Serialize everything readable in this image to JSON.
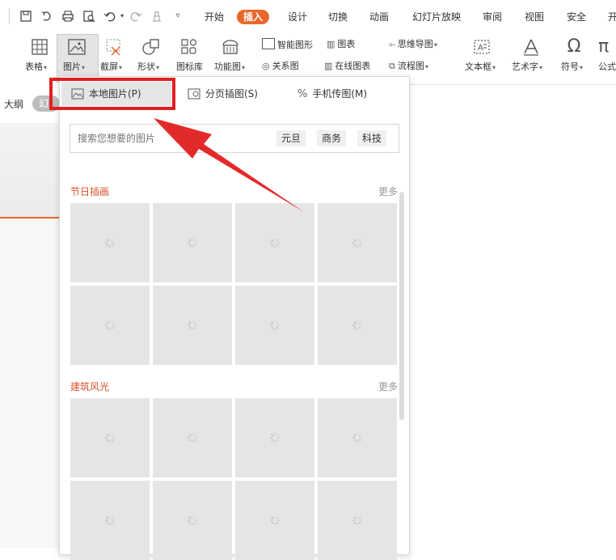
{
  "tabs": [
    "开始",
    "插入",
    "设计",
    "切换",
    "动画",
    "幻灯片放映",
    "审阅",
    "视图",
    "安全",
    "开"
  ],
  "active_tab": "插入",
  "ribbon": {
    "table": "表格",
    "picture": "图片",
    "screenshot": "截屏",
    "shape": "形状",
    "icon_lib": "图标库",
    "function_chart": "功能图",
    "smart_graphic": "智能图形",
    "chart": "图表",
    "mind_map": "思维导图",
    "relation": "关系图",
    "online_chart": "在线图表",
    "flowchart": "流程图",
    "textbox": "文本框",
    "art_text": "艺术字",
    "symbol": "符号",
    "formula": "公式"
  },
  "left_panel": {
    "outline_tab": "大纲",
    "slides_tab_partial": "幻"
  },
  "dropdown": {
    "local_picture": "本地图片(P)",
    "page_illustration": "分页插图(S)",
    "phone_transfer": "手机传图(M)",
    "search_placeholder": "搜索您想要的图片",
    "tags": [
      "元旦",
      "商务",
      "科技"
    ],
    "section1_title": "节日插画",
    "section2_title": "建筑风光",
    "more": "更多"
  },
  "colors": {
    "accent": "#e9672b",
    "highlight_box": "#e02020",
    "section_title": "#d9522b"
  }
}
